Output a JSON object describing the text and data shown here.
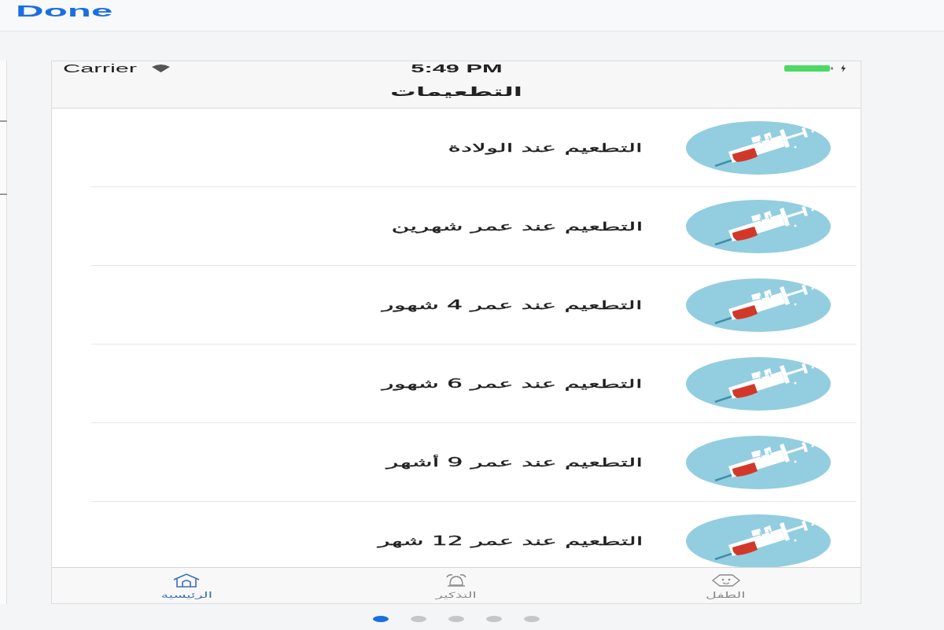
{
  "toolbar": {
    "done_button": "Done"
  },
  "status_bar": {
    "carrier": "Carrier",
    "time": "5:49 PM"
  },
  "nav_title": "التطعيمات",
  "vaccinations": [
    {
      "title": "التطعيم عند الولادة"
    },
    {
      "title": "التطعيم عند عمر شهرين"
    },
    {
      "title": "التطعيم عند عمر 4 شهور"
    },
    {
      "title": "التطعيم عند عمر 6 شهور"
    },
    {
      "title": "التطعيم عند عمر 9 أشهر"
    },
    {
      "title": "التطعيم عند عمر 12 شهر"
    }
  ],
  "tab_bar": [
    {
      "kind": "child",
      "label": "الطفل",
      "selected": false
    },
    {
      "kind": "reminder",
      "label": "التذكير",
      "selected": false
    },
    {
      "kind": "home",
      "label": "الرئيسية",
      "selected": true
    }
  ],
  "page_dots": [
    {
      "selected": true
    },
    {
      "selected": false
    },
    {
      "selected": false
    },
    {
      "selected": false
    },
    {
      "selected": false
    }
  ]
}
